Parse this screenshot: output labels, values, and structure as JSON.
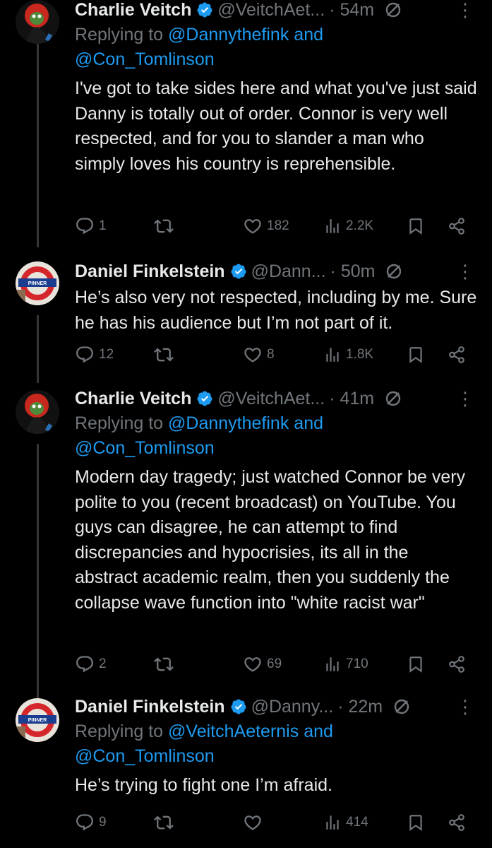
{
  "tweets": [
    {
      "name": "Charlie Veitch",
      "handle": "@VeitchAet...",
      "time": "· 54m",
      "replying_prefix": "Replying to",
      "replying_mention1": "@Dannythefink",
      "replying_and": "and",
      "replying_mention2": "@Con_Tomlinson",
      "text": "I've got to take sides here and what you've just said Danny is totally out of order. Connor is very well respected, and for you to slander a man who simply loves his country is reprehensible.",
      "replies": "1",
      "retweets": "",
      "likes": "182",
      "views": "2.2K",
      "avatar": "frog-avatar"
    },
    {
      "name": "Daniel Finkelstein",
      "handle": "@Dann...",
      "time": "· 50m",
      "text": "He’s also very not respected, including by me. Sure he has his audience but I’m not part of it.",
      "replies": "12",
      "retweets": "",
      "likes": "8",
      "views": "1.8K",
      "avatar": "pinner-roundel-avatar",
      "avatar_label": "PINNER"
    },
    {
      "name": "Charlie Veitch",
      "handle": "@VeitchAet...",
      "time": "· 41m",
      "replying_prefix": "Replying to",
      "replying_mention1": "@Dannythefink",
      "replying_and": "and",
      "replying_mention2": "@Con_Tomlinson",
      "text": "Modern day tragedy; just watched Connor be very polite to you (recent broadcast) on YouTube. You guys can disagree, he can attempt to find discrepancies and hypocrisies,  its all in the abstract academic realm, then you suddenly the collapse wave function into \"white racist war\"",
      "replies": "2",
      "retweets": "",
      "likes": "69",
      "views": "710",
      "avatar": "frog-avatar"
    },
    {
      "name": "Daniel Finkelstein",
      "handle": "@Danny...",
      "time": "· 22m",
      "replying_prefix": "Replying to",
      "replying_mention1": "@VeitchAeternis",
      "replying_and": "and",
      "replying_mention2": "@Con_Tomlinson",
      "text": "He’s trying to fight one I’m afraid.",
      "replies": "9",
      "retweets": "",
      "likes": "",
      "views": "414",
      "avatar": "pinner-roundel-avatar",
      "avatar_label": "PINNER"
    }
  ],
  "colors": {
    "background": "#000000",
    "text": "#e7e9ea",
    "secondary": "#71767b",
    "link": "#1d9bf0",
    "verified": "#1d9bf0",
    "thread_line": "#333639"
  }
}
